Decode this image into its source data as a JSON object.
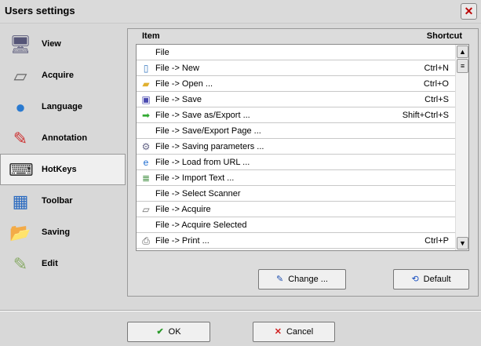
{
  "window": {
    "title": "Users settings"
  },
  "sidebar": {
    "items": [
      {
        "label": "View",
        "icon": "monitor-icon"
      },
      {
        "label": "Acquire",
        "icon": "scanner-icon"
      },
      {
        "label": "Language",
        "icon": "globe-icon"
      },
      {
        "label": "Annotation",
        "icon": "annotation-icon"
      },
      {
        "label": "HotKeys",
        "icon": "keyboard-icon",
        "selected": true
      },
      {
        "label": "Toolbar",
        "icon": "toolbar-icon"
      },
      {
        "label": "Saving",
        "icon": "folder-icon"
      },
      {
        "label": "Edit",
        "icon": "edit-icon"
      }
    ]
  },
  "hotkeys": {
    "columns": {
      "item": "Item",
      "shortcut": "Shortcut"
    },
    "rows": [
      {
        "item": "File",
        "shortcut": "",
        "icon": ""
      },
      {
        "item": "File -> New",
        "shortcut": "Ctrl+N",
        "icon": "new-file-icon"
      },
      {
        "item": "File -> Open ...",
        "shortcut": "Ctrl+O",
        "icon": "open-folder-icon"
      },
      {
        "item": "File -> Save",
        "shortcut": "Ctrl+S",
        "icon": "save-icon"
      },
      {
        "item": "File -> Save as/Export ...",
        "shortcut": "Shift+Ctrl+S",
        "icon": "export-icon"
      },
      {
        "item": "File -> Save/Export Page ...",
        "shortcut": "",
        "icon": ""
      },
      {
        "item": "File -> Saving parameters ...",
        "shortcut": "",
        "icon": "gear-icon"
      },
      {
        "item": "File -> Load from URL ...",
        "shortcut": "",
        "icon": "browser-icon"
      },
      {
        "item": "File -> Import Text ...",
        "shortcut": "",
        "icon": "text-file-icon"
      },
      {
        "item": "File -> Select Scanner",
        "shortcut": "",
        "icon": ""
      },
      {
        "item": "File -> Acquire",
        "shortcut": "",
        "icon": "scanner-icon"
      },
      {
        "item": "File -> Acquire Selected",
        "shortcut": "",
        "icon": ""
      },
      {
        "item": "File -> Print ...",
        "shortcut": "Ctrl+P",
        "icon": "printer-icon"
      }
    ],
    "change_label": "Change ...",
    "default_label": "Default"
  },
  "footer": {
    "ok_label": "OK",
    "cancel_label": "Cancel"
  }
}
